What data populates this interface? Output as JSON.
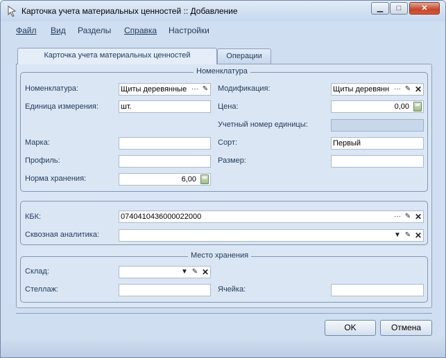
{
  "window": {
    "title": "Карточка учета материальных ценностей :: Добавление",
    "min_icon": "minimize-icon",
    "max_icon": "maximize-icon",
    "close_icon": "close-icon"
  },
  "menu": [
    "Файл",
    "Вид",
    "Разделы",
    "Справка",
    "Настройки"
  ],
  "tabs": [
    "Карточка учета материальных ценностей",
    "Операции"
  ],
  "nomenclature": {
    "title": "Номенклатура",
    "nom_label": "Номенклатура:",
    "nom_value": "Щиты деревянные",
    "mod_label": "Модификация:",
    "mod_value": "Щиты деревянн",
    "unit_label": "Единица измерения:",
    "unit_value": "шт.",
    "price_label": "Цена:",
    "price_value": "0,00",
    "acct_label": "Учетный номер единицы:",
    "acct_value": "",
    "brand_label": "Марка:",
    "brand_value": "",
    "grade_label": "Сорт:",
    "grade_value": "Первый",
    "profile_label": "Профиль:",
    "profile_value": "",
    "size_label": "Размер:",
    "size_value": "",
    "norm_label": "Норма хранения:",
    "norm_value": "6,00"
  },
  "kbk": {
    "kbk_label": "КБК:",
    "kbk_value": "0740410436000022000",
    "analytics_label": "Сквозная аналитика:",
    "analytics_value": ""
  },
  "storage": {
    "title": "Место хранения",
    "warehouse_label": "Склад:",
    "warehouse_value": "",
    "rack_label": "Стеллаж:",
    "rack_value": "",
    "cell_label": "Ячейка:",
    "cell_value": ""
  },
  "buttons": {
    "ok": "OK",
    "cancel": "Отмена"
  },
  "icons": {
    "ellipsis": "···",
    "pick": "✎",
    "clear": "✕",
    "dropdown": "▼"
  }
}
